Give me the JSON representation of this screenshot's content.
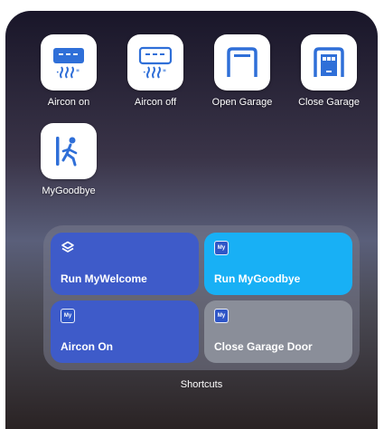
{
  "apps": [
    {
      "label": "Aircon on",
      "icon": "aircon-icon"
    },
    {
      "label": "Aircon off",
      "icon": "aircon-icon"
    },
    {
      "label": "Open Garage",
      "icon": "garage-open-icon"
    },
    {
      "label": "Close Garage",
      "icon": "garage-close-icon"
    },
    {
      "label": "MyGoodbye",
      "icon": "walking-person-icon"
    }
  ],
  "shortcuts_widget": {
    "caption": "Shortcuts",
    "tiles": [
      {
        "label": "Run MyWelcome",
        "icon": "layers-icon",
        "color": "#3e5bc9"
      },
      {
        "label": "Run MyGoodbye",
        "icon": "my-badge-icon",
        "color": "#18b0f5"
      },
      {
        "label": "Aircon On",
        "icon": "my-badge-icon",
        "color": "#3e5bc9"
      },
      {
        "label": "Close Garage Door",
        "icon": "my-badge-icon",
        "color": "#8a8e99"
      }
    ],
    "badge_text": "My"
  },
  "colors": {
    "icon_blue": "#2f6fd8",
    "app_tile_bg": "#ffffff"
  }
}
